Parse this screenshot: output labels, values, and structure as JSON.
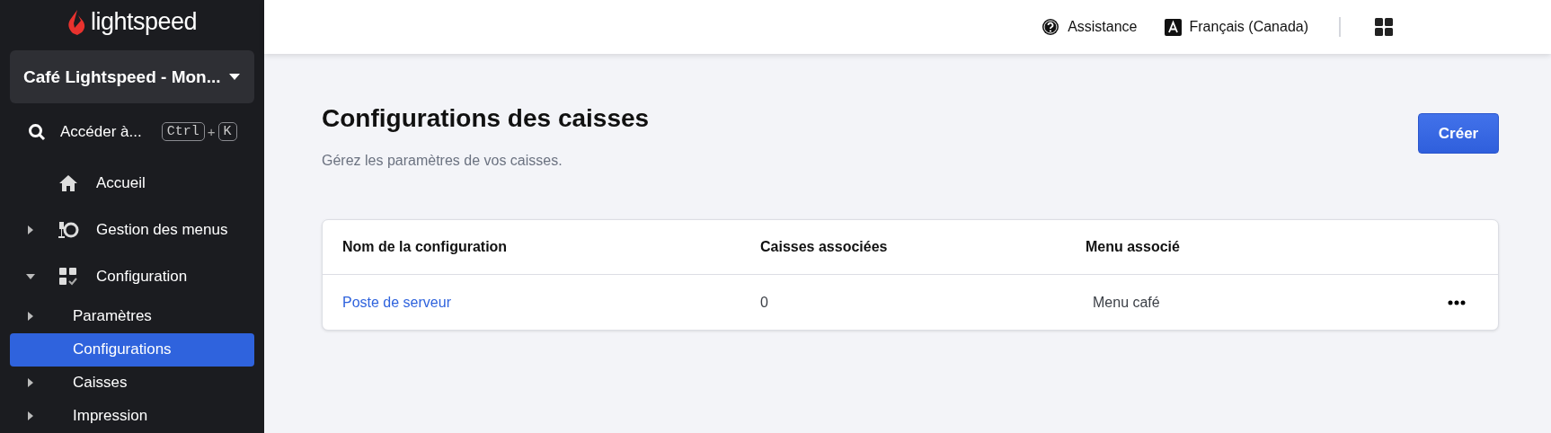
{
  "sidebar": {
    "logo": "lightspeed",
    "store": "Café Lightspeed - Mon...",
    "search": {
      "label": "Accéder à...",
      "keys": [
        "Ctrl",
        "K"
      ],
      "joiner": "+"
    },
    "items": [
      {
        "kind": "link",
        "label": "Accueil",
        "selected": false
      },
      {
        "kind": "group",
        "label": "Gestion des menus",
        "expanded": false,
        "selected": false
      },
      {
        "kind": "group",
        "label": "Configuration",
        "expanded": true,
        "selected": false,
        "children": [
          {
            "kind": "group",
            "label": "Paramètres",
            "expanded": false,
            "selected": false
          },
          {
            "kind": "link",
            "label": "Configurations",
            "selected": true
          },
          {
            "kind": "group",
            "label": "Caisses",
            "expanded": false,
            "selected": false
          },
          {
            "kind": "group",
            "label": "Impression",
            "expanded": false,
            "selected": false
          }
        ]
      }
    ]
  },
  "header": {
    "help": "Assistance",
    "language": "Français (Canada)"
  },
  "page": {
    "title": "Configurations des caisses",
    "subtitle": "Gérez les paramètres de vos caisses.",
    "create_button": "Créer"
  },
  "table": {
    "columns": [
      "Nom de la configuration",
      "Caisses associées",
      "Menu associé"
    ],
    "rows": [
      {
        "name": "Poste de serveur",
        "registers": "0",
        "menu": "Menu café"
      }
    ]
  }
}
